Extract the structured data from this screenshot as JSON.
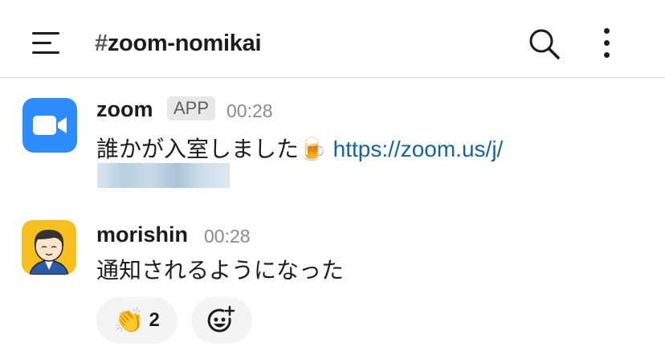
{
  "header": {
    "hash": "#",
    "channel": "zoom-nomikai",
    "menu_icon": "hamburger-icon",
    "search_icon": "search-icon",
    "more_icon": "kebab-icon"
  },
  "messages": [
    {
      "author": "zoom",
      "badge": "APP",
      "time": "00:28",
      "text": "誰かが入室しました",
      "emoji": "🍺",
      "link": "https://zoom.us/j/",
      "avatar_color": "#2d8cff"
    },
    {
      "author": "morishin",
      "time": "00:28",
      "text": "通知されるようになった",
      "avatar_color": "#f7c01e",
      "reactions": [
        {
          "emoji": "👏",
          "count": "2"
        }
      ],
      "add_reaction_icon": "add-reaction-icon"
    }
  ]
}
